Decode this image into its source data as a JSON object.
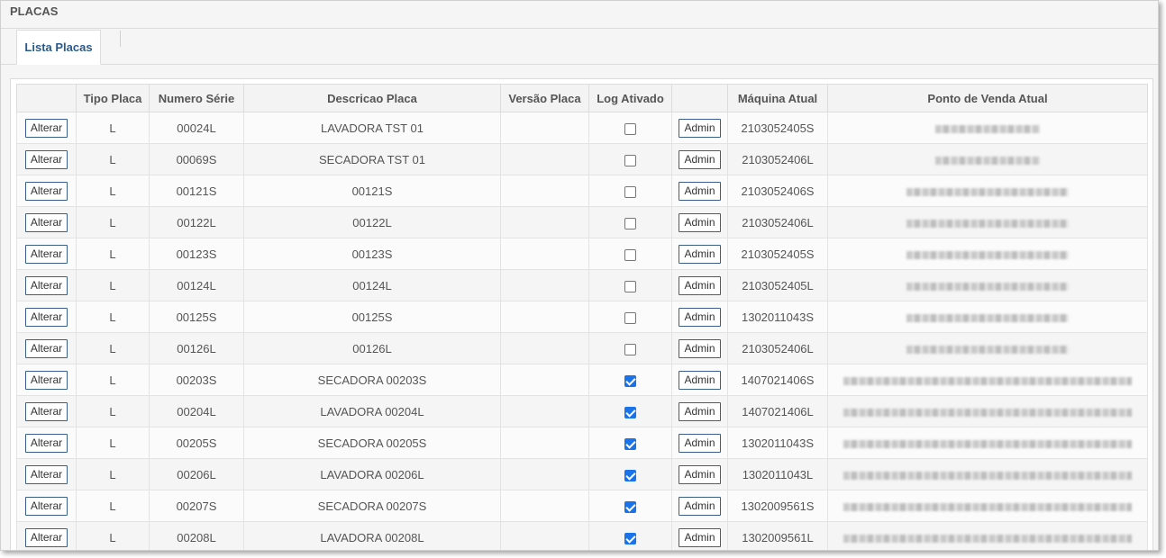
{
  "page_title": "PLACAS",
  "tab_label": "Lista Placas",
  "columns": [
    "",
    "Tipo Placa",
    "Numero Série",
    "Descricao Placa",
    "Versão Placa",
    "Log Ativado",
    "",
    "Máquina Atual",
    "Ponto de Venda Atual"
  ],
  "button_labels": {
    "alterar": "Alterar",
    "admin": "Admin"
  },
  "rows": [
    {
      "tipo": "L",
      "serie": "00024L",
      "descricao": "LAVADORA TST 01",
      "versao": "",
      "log": false,
      "maquina": "2103052405S",
      "pdv_blur": "short"
    },
    {
      "tipo": "L",
      "serie": "00069S",
      "descricao": "SECADORA TST 01",
      "versao": "",
      "log": false,
      "maquina": "2103052406L",
      "pdv_blur": "short"
    },
    {
      "tipo": "L",
      "serie": "00121S",
      "descricao": "00121S",
      "versao": "",
      "log": false,
      "maquina": "2103052406S",
      "pdv_blur": "medium"
    },
    {
      "tipo": "L",
      "serie": "00122L",
      "descricao": "00122L",
      "versao": "",
      "log": false,
      "maquina": "2103052406L",
      "pdv_blur": "medium"
    },
    {
      "tipo": "L",
      "serie": "00123S",
      "descricao": "00123S",
      "versao": "",
      "log": false,
      "maquina": "2103052405S",
      "pdv_blur": "medium"
    },
    {
      "tipo": "L",
      "serie": "00124L",
      "descricao": "00124L",
      "versao": "",
      "log": false,
      "maquina": "2103052405L",
      "pdv_blur": "medium"
    },
    {
      "tipo": "L",
      "serie": "00125S",
      "descricao": "00125S",
      "versao": "",
      "log": false,
      "maquina": "1302011043S",
      "pdv_blur": "medium"
    },
    {
      "tipo": "L",
      "serie": "00126L",
      "descricao": "00126L",
      "versao": "",
      "log": false,
      "maquina": "2103052406L",
      "pdv_blur": "medium"
    },
    {
      "tipo": "L",
      "serie": "00203S",
      "descricao": "SECADORA 00203S",
      "versao": "",
      "log": true,
      "maquina": "1407021406S",
      "pdv_blur": "long"
    },
    {
      "tipo": "L",
      "serie": "00204L",
      "descricao": "LAVADORA 00204L",
      "versao": "",
      "log": true,
      "maquina": "1407021406L",
      "pdv_blur": "long"
    },
    {
      "tipo": "L",
      "serie": "00205S",
      "descricao": "SECADORA 00205S",
      "versao": "",
      "log": true,
      "maquina": "1302011043S",
      "pdv_blur": "long"
    },
    {
      "tipo": "L",
      "serie": "00206L",
      "descricao": "LAVADORA 00206L",
      "versao": "",
      "log": true,
      "maquina": "1302011043L",
      "pdv_blur": "long"
    },
    {
      "tipo": "L",
      "serie": "00207S",
      "descricao": "SECADORA 00207S",
      "versao": "",
      "log": true,
      "maquina": "1302009561S",
      "pdv_blur": "long"
    },
    {
      "tipo": "L",
      "serie": "00208L",
      "descricao": "LAVADORA 00208L",
      "versao": "",
      "log": true,
      "maquina": "1302009561L",
      "pdv_blur": "long"
    }
  ]
}
